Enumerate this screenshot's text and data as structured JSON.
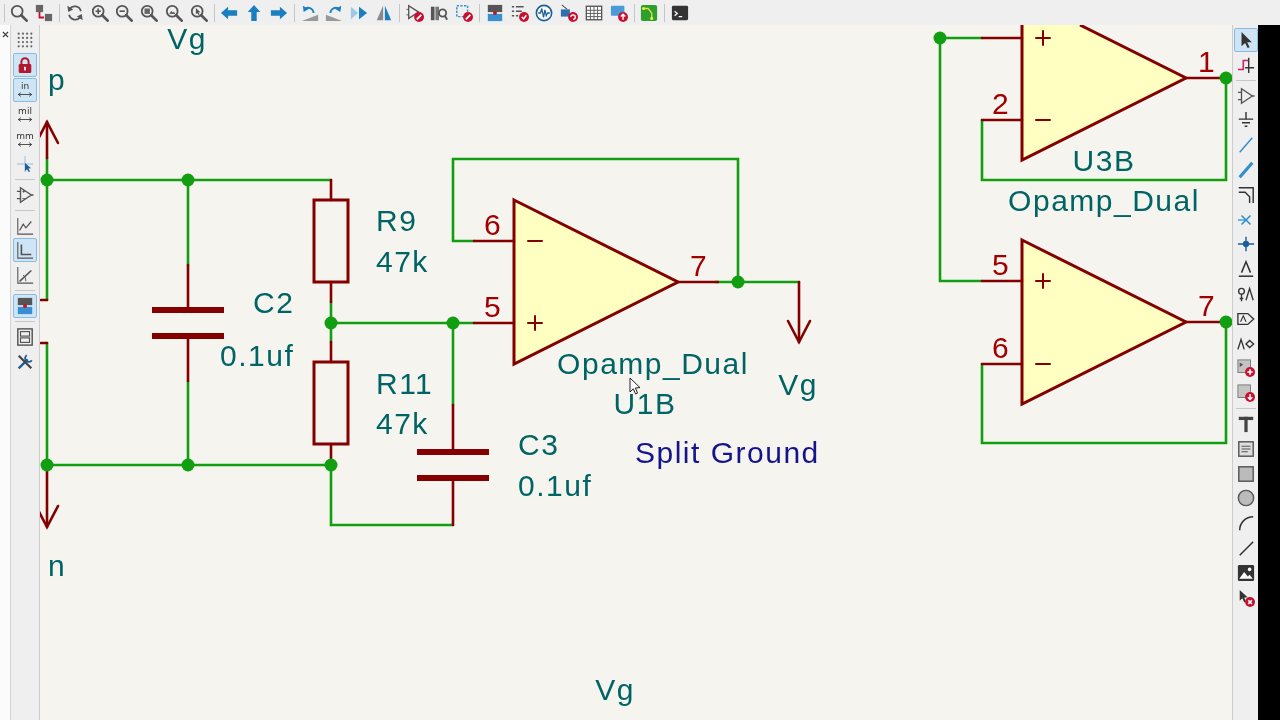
{
  "left_toolbar": {
    "tools": [
      {
        "kind": "icon",
        "selected": false
      },
      {
        "kind": "icon",
        "selected": true
      },
      {
        "kind": "unit",
        "label": "in",
        "selected": true
      },
      {
        "kind": "unit",
        "label": "mil",
        "selected": false
      },
      {
        "kind": "unit",
        "label": "mm",
        "selected": false
      },
      {
        "kind": "icon",
        "selected": false
      },
      {
        "kind": "icon",
        "selected": false
      },
      {
        "kind": "icon",
        "selected": false
      },
      {
        "kind": "icon",
        "selected": true
      },
      {
        "kind": "icon",
        "selected": false
      },
      {
        "kind": "icon",
        "selected": true
      },
      {
        "kind": "icon",
        "selected": false
      },
      {
        "kind": "icon",
        "selected": false
      }
    ]
  },
  "schematic": {
    "power_ports": [
      {
        "name": "Vg"
      },
      {
        "name": "p"
      },
      {
        "name": "Vg"
      },
      {
        "name": "n"
      },
      {
        "name": "Vg"
      }
    ],
    "resistors": [
      {
        "reference": "R9",
        "value": "47k"
      },
      {
        "reference": "R11",
        "value": "47k"
      }
    ],
    "capacitors": [
      {
        "reference": "C2",
        "value": "0.1uf"
      },
      {
        "reference": "C3",
        "value": "0.1uf"
      }
    ],
    "opamps": [
      {
        "value": "Opamp_Dual",
        "reference": "U1B",
        "pins": {
          "minus": "6",
          "plus": "5",
          "output": "7"
        }
      },
      {
        "reference": "U3B",
        "value": "Opamp_Dual",
        "pins": {
          "minus": "2",
          "output": "1"
        }
      },
      {
        "pins": {
          "plus": "5",
          "minus": "6",
          "output": "7"
        }
      }
    ],
    "notes": [
      {
        "text": "Split Ground"
      }
    ]
  },
  "right_toolbar": {
    "tools": [
      {
        "selected": true
      },
      {
        "selected": false
      },
      {
        "selected": false
      },
      {
        "selected": false
      },
      {
        "selected": false
      },
      {
        "selected": false
      },
      {
        "selected": false
      },
      {
        "selected": false
      },
      {
        "selected": false
      },
      {
        "selected": false
      },
      {
        "selected": false
      },
      {
        "selected": false
      },
      {
        "selected": false
      },
      {
        "selected": false
      },
      {
        "selected": false
      },
      {
        "selected": false
      },
      {
        "selected": false
      },
      {
        "selected": false
      },
      {
        "selected": false
      },
      {
        "selected": false
      },
      {
        "selected": false
      },
      {
        "selected": false
      },
      {
        "selected": false
      }
    ]
  }
}
